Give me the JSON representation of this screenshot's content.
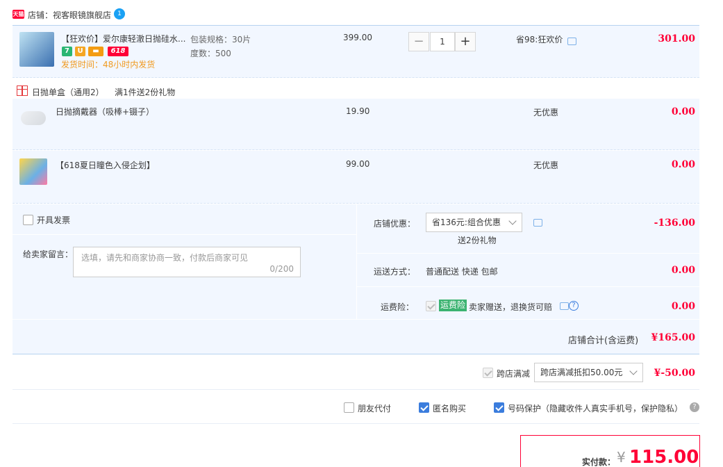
{
  "shop": {
    "badge": "天猫",
    "label": "店铺：视客眼镜旗舰店",
    "ww_glyph": "1"
  },
  "item1": {
    "title": "【狂欢价】爱尔康轻澈日抛硅水...",
    "tags": [
      "7",
      "U",
      "▬",
      "618"
    ],
    "ship": "发货时间：48小时内发货",
    "spec1": "包装规格：30片",
    "spec2": "度数：500",
    "price": "399.00",
    "qty": "1",
    "promo": "省98:狂欢价",
    "subtotal": "301.00"
  },
  "gift_header": {
    "name": "日抛单盒（通用2）",
    "rule": "满1件送2份礼物"
  },
  "item2": {
    "title": "日抛摘戴器（吸棒+镊子）",
    "price": "19.90",
    "promo": "无优惠",
    "subtotal": "0.00"
  },
  "item3": {
    "title": "【618夏日瞳色入侵企划】",
    "price": "99.00",
    "promo": "无优惠",
    "subtotal": "0.00"
  },
  "invoice": {
    "label": "开具发票"
  },
  "message": {
    "label": "给卖家留言：",
    "placeholder": "选填，请先和商家协商一致，付款后商家可见",
    "counter": "0/200"
  },
  "shop_discount": {
    "label": "店铺优惠：",
    "selected": "省136元:组合优惠",
    "gift": "送2份礼物",
    "amount": "-136.00"
  },
  "delivery": {
    "label": "运送方式：",
    "value": "普通配送 快递 包邮",
    "amount": "0.00"
  },
  "insurance": {
    "label": "运费险：",
    "badge": "运费险",
    "desc": "卖家赠送，退换货可赔",
    "amount": "0.00"
  },
  "shop_total": {
    "label": "店铺合计(含运费)",
    "amount": "¥165.00"
  },
  "cross_shop": {
    "label": "跨店满减",
    "selected": "跨店满减抵扣50.00元",
    "amount": "¥-50.00"
  },
  "options": {
    "friend_pay": "朋友代付",
    "anonymous": "匿名购买",
    "privacy": "号码保护（隐藏收件人真实手机号，保护隐私）"
  },
  "pay": {
    "label": "实付款：",
    "currency": "¥",
    "amount": "115.00"
  },
  "colors": {
    "accent_red": "#ff0036",
    "blue_bg": "#f2f7ff",
    "check_blue": "#3b7ddd",
    "green_badge": "#3cb371"
  }
}
